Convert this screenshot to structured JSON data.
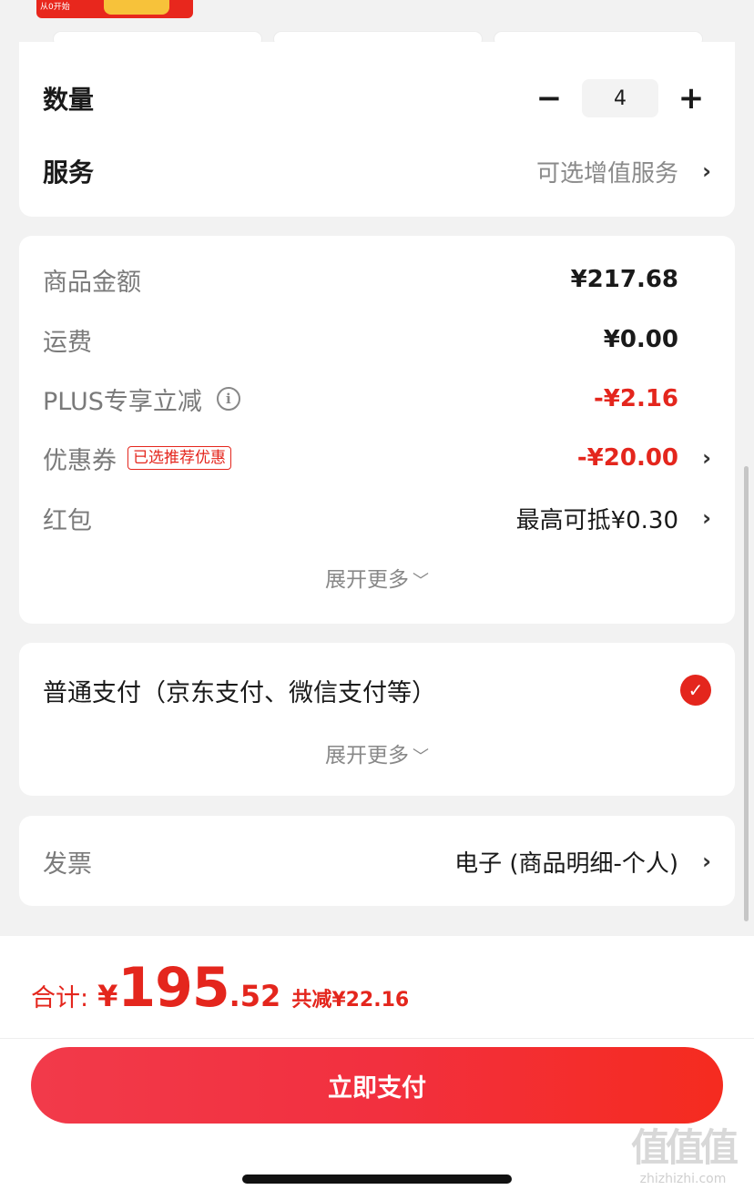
{
  "banner": {
    "promo_text": "从0开始"
  },
  "quantity": {
    "label": "数量",
    "value": "4",
    "minus": "−",
    "plus": "+"
  },
  "service": {
    "label": "服务",
    "value": "可选增值服务"
  },
  "amounts": {
    "goods": {
      "label": "商品金额",
      "value": "¥217.68"
    },
    "shipping": {
      "label": "运费",
      "value": "¥0.00"
    },
    "plus": {
      "label": "PLUS专享立减",
      "value": "-¥2.16"
    },
    "coupon": {
      "label": "优惠券",
      "tag": "已选推荐优惠",
      "value": "-¥20.00"
    },
    "redpacket": {
      "label": "红包",
      "value": "最高可抵¥0.30"
    },
    "expand": "展开更多"
  },
  "payment": {
    "method": "普通支付（京东支付、微信支付等）",
    "expand": "展开更多"
  },
  "invoice": {
    "label": "发票",
    "value": "电子 (商品明细-个人)"
  },
  "footer": {
    "total_label": "合计:",
    "currency": "¥",
    "total_int": "195",
    "total_dec": ".52",
    "saved": "共减¥22.16",
    "pay_button": "立即支付"
  },
  "watermark": {
    "logo": "值值值",
    "site": "zhizhizhi.com"
  },
  "colors": {
    "accent": "#e4261d",
    "background": "#f2f2f2",
    "card": "#ffffff"
  }
}
